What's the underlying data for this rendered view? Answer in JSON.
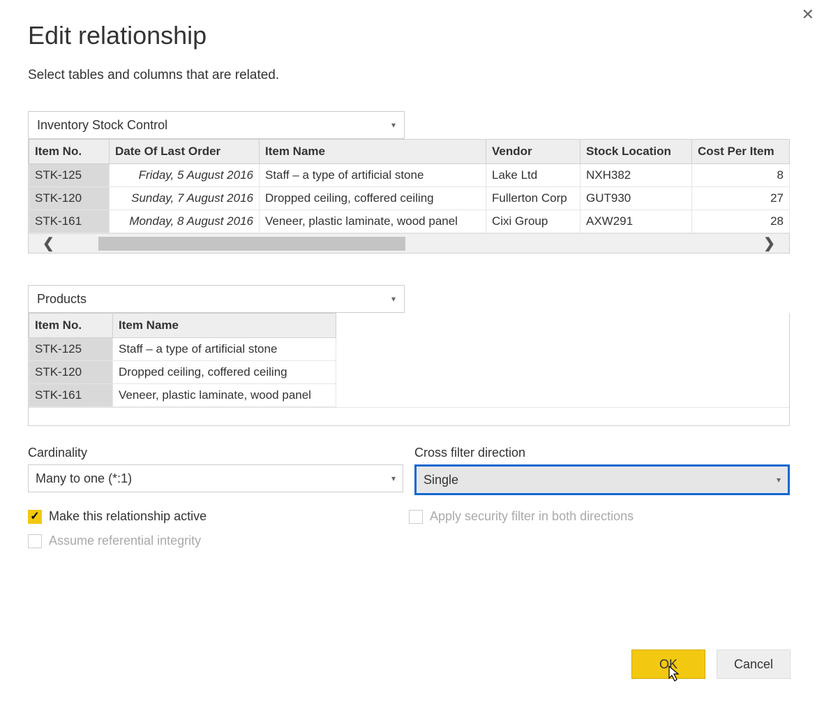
{
  "dialog": {
    "title": "Edit relationship",
    "subtitle": "Select tables and columns that are related."
  },
  "first_table": {
    "selected": "Inventory Stock Control",
    "headers": [
      "Item No.",
      "Date Of Last Order",
      "Item Name",
      "Vendor",
      "Stock Location",
      "Cost Per Item"
    ],
    "rows": [
      {
        "item_no": "STK-125",
        "date": "Friday, 5 August 2016",
        "name": "Staff – a type of artificial stone",
        "vendor": "Lake Ltd",
        "loc": "NXH382",
        "cost": "8"
      },
      {
        "item_no": "STK-120",
        "date": "Sunday, 7 August 2016",
        "name": "Dropped ceiling, coffered ceiling",
        "vendor": "Fullerton Corp",
        "loc": "GUT930",
        "cost": "27"
      },
      {
        "item_no": "STK-161",
        "date": "Monday, 8 August 2016",
        "name": "Veneer, plastic laminate, wood panel",
        "vendor": "Cixi Group",
        "loc": "AXW291",
        "cost": "28"
      }
    ]
  },
  "second_table": {
    "selected": "Products",
    "headers": [
      "Item No.",
      "Item Name"
    ],
    "rows": [
      {
        "item_no": "STK-125",
        "name": "Staff – a type of artificial stone"
      },
      {
        "item_no": "STK-120",
        "name": "Dropped ceiling, coffered ceiling"
      },
      {
        "item_no": "STK-161",
        "name": "Veneer, plastic laminate, wood panel"
      }
    ]
  },
  "cardinality": {
    "label": "Cardinality",
    "value": "Many to one (*:1)"
  },
  "cross_filter": {
    "label": "Cross filter direction",
    "value": "Single"
  },
  "checkboxes": {
    "active": "Make this relationship active",
    "referential": "Assume referential integrity",
    "security": "Apply security filter in both directions"
  },
  "buttons": {
    "ok": "OK",
    "cancel": "Cancel"
  }
}
